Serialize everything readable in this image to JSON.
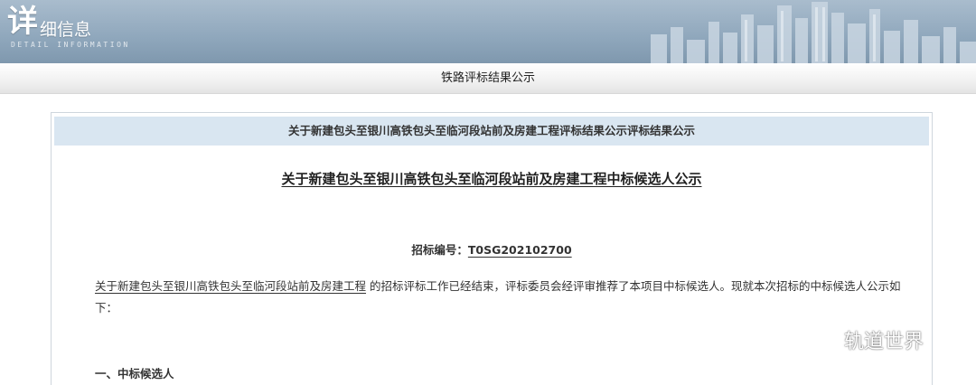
{
  "header": {
    "brand_big": "详",
    "brand_small": "细信息",
    "brand_sub": "DETAIL INFORMATION",
    "skyline_icon": "city-skyline-icon"
  },
  "section_bar": {
    "title": "铁路评标结果公示"
  },
  "panel": {
    "heading": "关于新建包头至银川高铁包头至临河段站前及房建工程评标结果公示评标结果公示",
    "notice_title": "关于新建包头至银川高铁包头至临河段站前及房建工程中标候选人公示",
    "bid_no_label": "招标编号：",
    "bid_no_value": "T0SG202102700",
    "body_link": "关于新建包头至银川高铁包头至临河段站前及房建工程",
    "body_rest": "的招标评标工作已经结束，评标委员会经评审推荐了本项目中标候选人。现就本次招标的中标候选人公示如下：",
    "section_1": "一、中标候选人"
  },
  "watermark": {
    "icon": "wechat-icon",
    "text": "轨道世界"
  },
  "colors": {
    "banner": "#8fa7bc",
    "panel_head": "#d9e6f1",
    "frame_border": "#cfd6dd"
  }
}
